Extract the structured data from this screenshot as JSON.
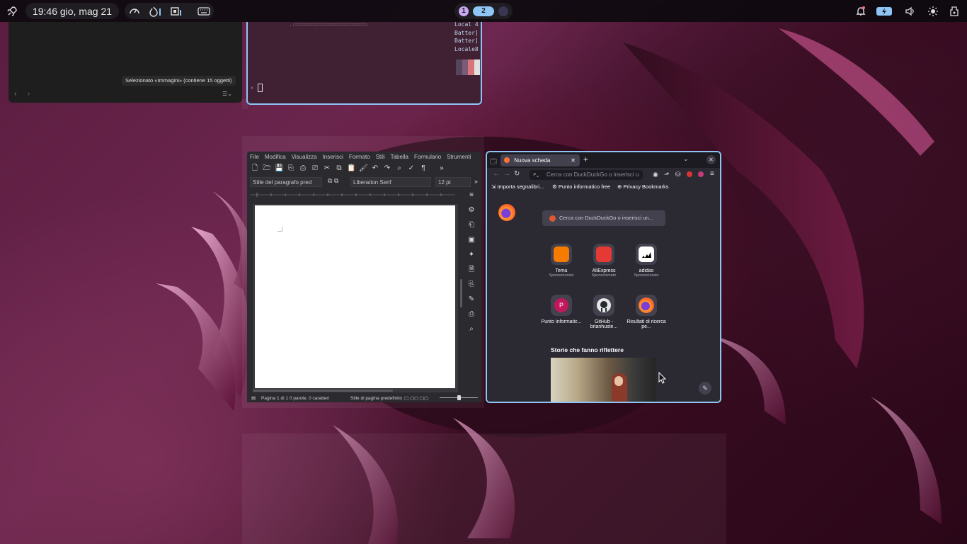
{
  "topbar": {
    "clock": "19:46 gio, mag 21",
    "workspaces": [
      "1",
      "2",
      ""
    ],
    "icons": [
      "rocket-icon",
      "gauge-icon",
      "temperature-icon",
      "cpu-icon",
      "keyboard-icon",
      "bell-icon",
      "battery-charging-icon",
      "volume-icon",
      "brightness-icon",
      "power-menu-icon"
    ],
    "accent": "#8ec5f5"
  },
  "files_window": {
    "status_text": "Selezionato «Immagini» (contiene 15 oggetti)"
  },
  "terminal": {
    "lines": [
      "Local  4",
      "Batter]",
      "Batter]",
      "Locale8"
    ],
    "art_line": ".:========================:",
    "prompt": "›"
  },
  "writer": {
    "menu": [
      "File",
      "Modifica",
      "Visualizza",
      "Inserisci",
      "Formato",
      "Stili",
      "Tabella",
      "Formulario",
      "Strumenti"
    ],
    "paragraph_style": "Stile del paragrafo pred",
    "font_name": "Liberation Serif",
    "font_size": "12 pt",
    "status": {
      "page": "Pagina 1 di 1",
      "words": "0 parole, 0 caratteri",
      "page_style": "Stile di pagina predefinito"
    }
  },
  "firefox": {
    "tab_title": "Nuova scheda",
    "url_placeholder": "Cerca con DuckDuckGo o inserisci u",
    "search_placeholder": "Cerca con DuckDuckGo o inserisci un...",
    "bookmarks": [
      "Importa segnalibri...",
      "Punto informatico free",
      "Privacy Bookmarks"
    ],
    "shortcuts": [
      {
        "label": "Temu",
        "sub": "Sponsorizzato",
        "icon": "temu-icon",
        "color": "#f57c00"
      },
      {
        "label": "AliExpress",
        "sub": "Sponsorizzato",
        "icon": "aliexpress-icon",
        "color": "#e53935"
      },
      {
        "label": "adidas",
        "sub": "Sponsorizzato",
        "icon": "adidas-icon",
        "color": "#111111"
      },
      {
        "label": "Punto Informatic...",
        "sub": "",
        "icon": "letter-p-icon",
        "color": "#c2185b"
      },
      {
        "label": "GitHub - brianhuste...",
        "sub": "",
        "icon": "github-icon",
        "color": "#24292e"
      },
      {
        "label": "Risultati di ricerca pe...",
        "sub": "",
        "icon": "firefox-icon",
        "color": "#ff7139"
      }
    ],
    "stories_heading": "Storie che fanno riflettere"
  }
}
